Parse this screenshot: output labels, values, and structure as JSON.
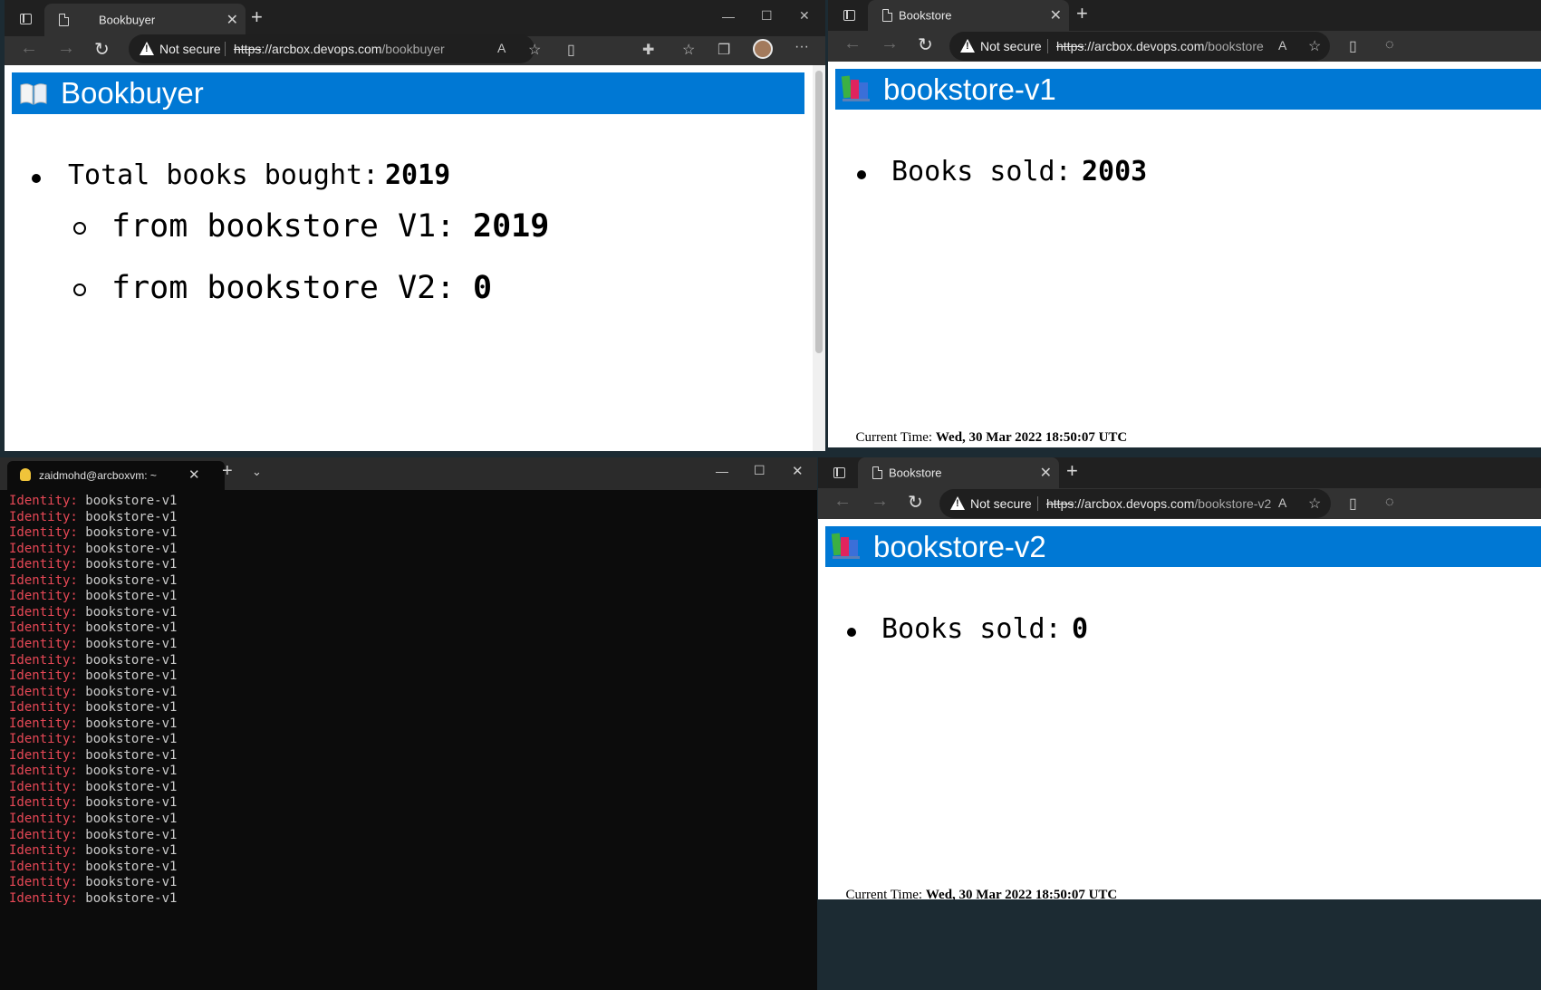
{
  "bookbuyer_window": {
    "tab_title": "Bookbuyer",
    "not_secure": "Not secure",
    "url_scheme": "https",
    "url_host": "://arcbox.devops.com",
    "url_path": "/bookbuyer",
    "heading": "Bookbuyer",
    "total_label": "Total books bought: ",
    "total_value": "2019",
    "v1_label": "from bookstore V1: ",
    "v1_value": "2019",
    "v2_label": "from bookstore V2: ",
    "v2_value": "0"
  },
  "bookstore_v1_window": {
    "tab_title": "Bookstore",
    "not_secure": "Not secure",
    "url_scheme": "https",
    "url_host": "://arcbox.devops.com",
    "url_path": "/bookstore",
    "heading": "bookstore-v1",
    "sold_label": "Books sold: ",
    "sold_value": "2003",
    "time_label": "Current Time: ",
    "time_value": "Wed, 30 Mar 2022 18:50:07 UTC"
  },
  "bookstore_v2_window": {
    "tab_title": "Bookstore",
    "not_secure": "Not secure",
    "url_scheme": "https",
    "url_host": "://arcbox.devops.com",
    "url_path": "/bookstore-v2",
    "heading": "bookstore-v2",
    "sold_label": "Books sold: ",
    "sold_value": "0",
    "time_label": "Current Time: ",
    "time_value": "Wed, 30 Mar 2022 18:50:07 UTC"
  },
  "terminal": {
    "tab_title": "zaidmohd@arcboxvm: ~",
    "line_key": "Identity:",
    "line_value": " bookstore-v1",
    "line_count": 26
  },
  "colors": {
    "banner": "#0078d4",
    "identity_key": "#e74856",
    "browser_chrome": "#323232"
  }
}
